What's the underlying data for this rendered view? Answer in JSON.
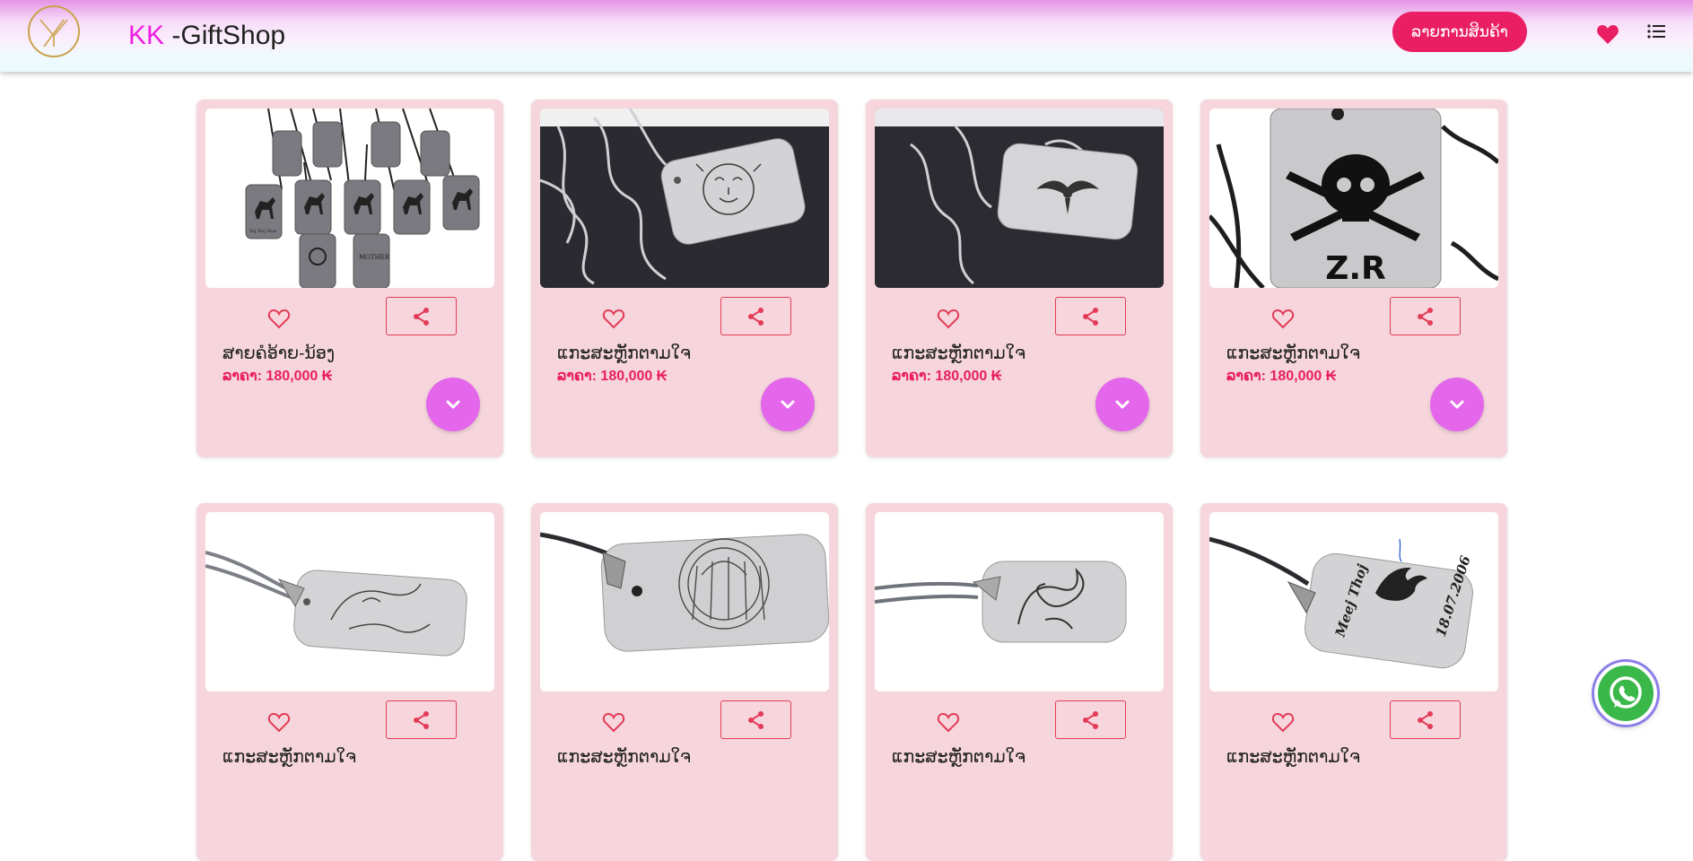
{
  "header": {
    "logo_text": "YX",
    "brand_prefix": "KK",
    "brand_name": " -GiftShop",
    "cta_label": "ລາຍການສິນຄ້າ",
    "favorites_icon": "heart-icon",
    "menu_icon": "list-icon"
  },
  "products": [
    {
      "title": "ສາຍຄໍອ້າຍ-ນ້ອງ",
      "price": "ລາຄາ: 180,000 ₭",
      "image": "horse-tags"
    },
    {
      "title": "ແກະສະຫຼັກຕາມໃຈ",
      "price": "ລາຄາ: 180,000 ₭",
      "image": "tiger-tag-box"
    },
    {
      "title": "ແກະສະຫຼັກຕາມໃຈ",
      "price": "ລາຄາ: 180,000 ₭",
      "image": "eagle-tag-box"
    },
    {
      "title": "ແກະສະຫຼັກຕາມໃຈ",
      "price": "ລາຄາ: 180,000 ₭",
      "image": "zoro-skull-tag"
    },
    {
      "title": "ແກະສະຫຼັກຕາມໃຈ",
      "price": "",
      "image": "tiger-tag-chain"
    },
    {
      "title": "ແກະສະຫຼັກຕາມໃຈ",
      "price": "",
      "image": "yantra-tag-chain"
    },
    {
      "title": "ແກະສະຫຼັກຕາມໃຈ",
      "price": "",
      "image": "dragon-tag-chain"
    },
    {
      "title": "ແກະສະຫຼັກຕາມໃຈ",
      "price": "",
      "image": "eagle-name-tag"
    }
  ],
  "engraved_text": {
    "zoro": "Z.R",
    "name_tag_name": "Meej Thoj",
    "name_tag_date": "18.07.2006",
    "horse_tag_caption": "Yaj Hoj Hua",
    "mother_tag": "MOTHER"
  },
  "icons": {
    "favorite": "heart-outline-icon",
    "share": "share-icon",
    "expand": "chevron-down-icon",
    "whatsapp": "whatsapp-icon"
  },
  "colors": {
    "accent": "#e91e63",
    "card_bg": "#f6d6dc",
    "expand_button": "#e366eb",
    "whatsapp": "#3bb84a"
  }
}
